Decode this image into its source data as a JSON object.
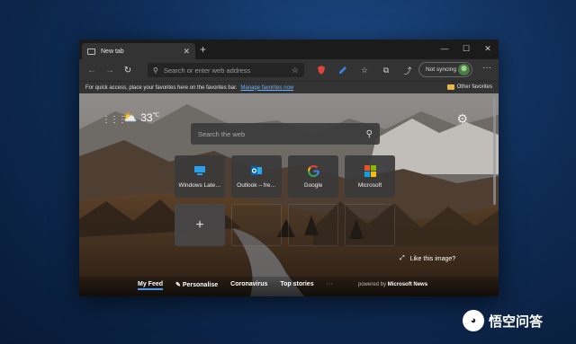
{
  "tab": {
    "title": "New tab"
  },
  "address_bar": {
    "placeholder": "Search or enter web address"
  },
  "profile": {
    "sync_label": "Not syncing"
  },
  "favorites_bar": {
    "prompt": "For quick access, place your favorites here on the favorites bar.",
    "manage_link": "Manage favorites now",
    "other_favorites": "Other favorites"
  },
  "weather": {
    "temp": "33",
    "unit": "℃"
  },
  "web_search": {
    "placeholder": "Search the web"
  },
  "quick_links": [
    {
      "label": "Windows Late…",
      "icon": "windows-latest-icon"
    },
    {
      "label": "Outlook – fre…",
      "icon": "outlook-icon"
    },
    {
      "label": "Google",
      "icon": "google-icon"
    },
    {
      "label": "Microsoft",
      "icon": "microsoft-icon"
    }
  ],
  "like_image": "Like this image?",
  "feed": {
    "tabs": [
      "My Feed",
      "Personalise",
      "Coronavirus",
      "Top stories"
    ],
    "more": "···",
    "powered_by_prefix": "powered by",
    "powered_by_brand": "Microsoft News"
  },
  "watermark": {
    "text": "悟空问答"
  },
  "colors": {
    "accent": "#3e9bff",
    "link": "#6fb2ff"
  }
}
